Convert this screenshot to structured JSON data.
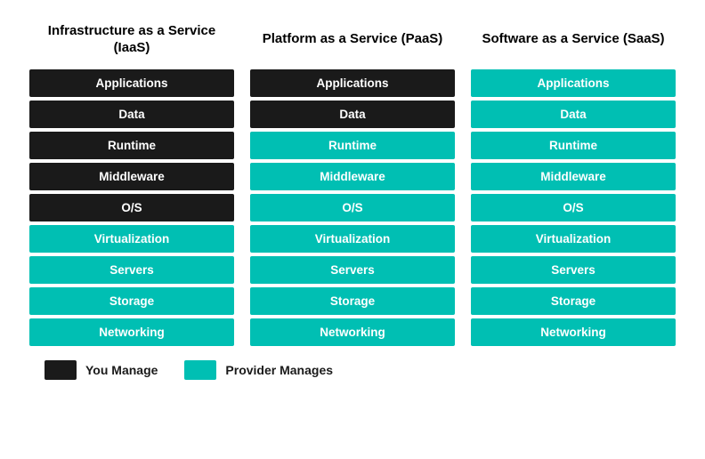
{
  "columns": [
    {
      "id": "iaas",
      "header": "Infrastructure as a Service (IaaS)",
      "layers": [
        {
          "label": "Applications",
          "type": "you-manage"
        },
        {
          "label": "Data",
          "type": "you-manage"
        },
        {
          "label": "Runtime",
          "type": "you-manage"
        },
        {
          "label": "Middleware",
          "type": "you-manage"
        },
        {
          "label": "O/S",
          "type": "you-manage"
        },
        {
          "label": "Virtualization",
          "type": "provider-manages"
        },
        {
          "label": "Servers",
          "type": "provider-manages"
        },
        {
          "label": "Storage",
          "type": "provider-manages"
        },
        {
          "label": "Networking",
          "type": "provider-manages"
        }
      ]
    },
    {
      "id": "paas",
      "header": "Platform as a Service (PaaS)",
      "layers": [
        {
          "label": "Applications",
          "type": "you-manage"
        },
        {
          "label": "Data",
          "type": "you-manage"
        },
        {
          "label": "Runtime",
          "type": "provider-manages"
        },
        {
          "label": "Middleware",
          "type": "provider-manages"
        },
        {
          "label": "O/S",
          "type": "provider-manages"
        },
        {
          "label": "Virtualization",
          "type": "provider-manages"
        },
        {
          "label": "Servers",
          "type": "provider-manages"
        },
        {
          "label": "Storage",
          "type": "provider-manages"
        },
        {
          "label": "Networking",
          "type": "provider-manages"
        }
      ]
    },
    {
      "id": "saas",
      "header": "Software as a Service (SaaS)",
      "layers": [
        {
          "label": "Applications",
          "type": "provider-manages"
        },
        {
          "label": "Data",
          "type": "provider-manages"
        },
        {
          "label": "Runtime",
          "type": "provider-manages"
        },
        {
          "label": "Middleware",
          "type": "provider-manages"
        },
        {
          "label": "O/S",
          "type": "provider-manages"
        },
        {
          "label": "Virtualization",
          "type": "provider-manages"
        },
        {
          "label": "Servers",
          "type": "provider-manages"
        },
        {
          "label": "Storage",
          "type": "provider-manages"
        },
        {
          "label": "Networking",
          "type": "provider-manages"
        }
      ]
    }
  ],
  "legend": {
    "items": [
      {
        "type": "you-manage",
        "color": "#1a1a1a",
        "label": "You Manage"
      },
      {
        "type": "provider-manages",
        "color": "#00bfb3",
        "label": "Provider Manages"
      }
    ]
  }
}
